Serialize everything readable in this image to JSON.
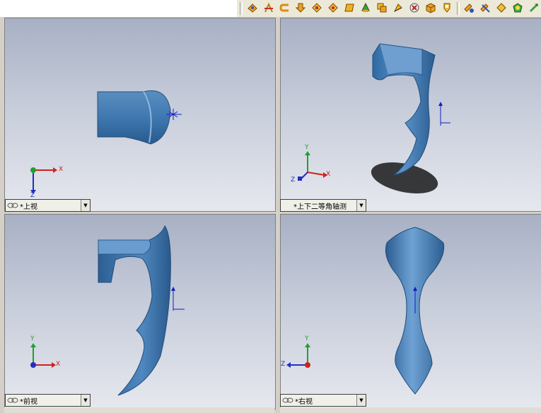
{
  "toolbar": {
    "icons": [
      "normal-to-icon",
      "front-view-icon",
      "back-view-icon",
      "left-view-icon",
      "right-view-icon",
      "top-view-icon",
      "bottom-view-icon",
      "isometric-icon",
      "trimetric-icon",
      "dimetric-icon",
      "single-view-icon",
      "two-view-icon",
      "four-view-icon",
      "link-views-icon",
      "section-view-icon",
      "zoom-icon",
      "shaded-icon",
      "perspective-icon"
    ]
  },
  "viewports": {
    "top_left": {
      "label": "*上视"
    },
    "top_right": {
      "label": "*上下二等角轴测"
    },
    "bottom_left": {
      "label": "*前视"
    },
    "bottom_right": {
      "label": "*右视"
    }
  },
  "axes": {
    "x": "X",
    "y": "Y",
    "z": "Z"
  }
}
